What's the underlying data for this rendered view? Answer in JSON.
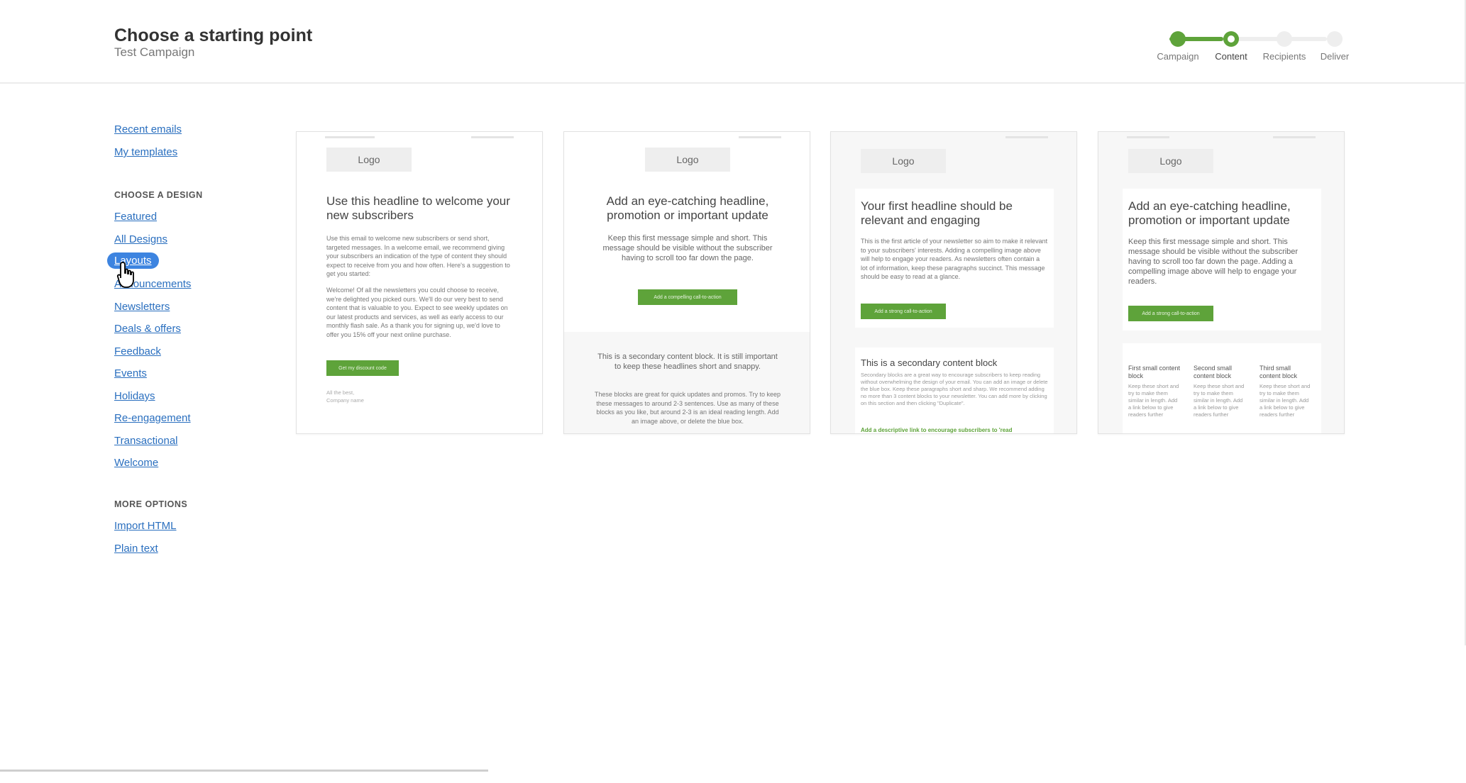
{
  "header": {
    "title": "Choose a starting point",
    "subtitle": "Test Campaign",
    "steps": [
      {
        "label": "Campaign",
        "state": "done"
      },
      {
        "label": "Content",
        "state": "current"
      },
      {
        "label": "Recipients",
        "state": "todo"
      },
      {
        "label": "Deliver",
        "state": "todo"
      }
    ],
    "progress_fraction": 0.33
  },
  "sidebar": {
    "recent_emails": "Recent emails",
    "my_templates": "My templates",
    "choose_design_heading": "CHOOSE A DESIGN",
    "designs": [
      "Featured",
      "All Designs",
      "Layouts",
      "Announcements",
      "Newsletters",
      "Deals & offers",
      "Feedback",
      "Events",
      "Holidays",
      "Re-engagement",
      "Transactional",
      "Welcome"
    ],
    "selected_design": "Layouts",
    "more_options_heading": "MORE OPTIONS",
    "import_html": "Import HTML",
    "plain_text": "Plain text"
  },
  "templates": [
    {
      "logo": "Logo",
      "headline": "Use this headline to welcome your new subscribers",
      "body1": "Use this email to welcome new subscribers or send short, targeted messages. In a welcome email, we recommend giving your subscribers an indication of the type of content they should expect to receive from you and how often. Here's a suggestion to get you started:",
      "body2": "Welcome! Of all the newsletters you could choose to receive, we're delighted you picked ours. We'll do our very best to send content that is valuable to you. Expect to see weekly updates on our latest products and services, as well as early access to our monthly flash sale. As a thank you for signing up, we'd love to offer you 15% off your next online purchase.",
      "cta": "Get my discount code",
      "signoff1": "All the best,",
      "signoff2": "Company name"
    },
    {
      "logo": "Logo",
      "headline": "Add an eye-catching headline, promotion or important update",
      "body1": "Keep this first message simple and short. This message should be visible without the subscriber having to scroll too far down the page.",
      "cta": "Add a compelling call-to-action",
      "secondary_headline": "This is a secondary content block. It is still important to keep these headlines short and snappy.",
      "body2": "These blocks are great for quick updates and promos. Try to keep these messages to around 2-3 sentences. Use as many of these blocks as you like, but around 2-3 is an ideal reading length. Add an image above, or delete the blue box."
    },
    {
      "logo": "Logo",
      "headline": "Your first headline should be relevant and engaging",
      "body1": "This is the first article of your newsletter so aim to make it relevant to your subscribers' interests. Adding a compelling image above will help to engage your readers. As newsletters often contain a lot of information, keep these paragraphs succinct. This message should be easy to read at a glance.",
      "cta": "Add a strong call-to-action",
      "secondary_headline": "This is a secondary content block",
      "body2": "Secondary blocks are a great way to encourage subscribers to keep reading without overwhelming the design of your email. You can add an image or delete the blue box. Keep these paragraphs short and sharp. We recommend adding no more than 3 content blocks to your newsletter. You can add more by clicking on this section and then clicking \"Duplicate\".",
      "link": "Add a descriptive link to encourage subscribers to 'read"
    },
    {
      "logo": "Logo",
      "headline": "Add an eye-catching headline, promotion or important update",
      "body1": "Keep this first message simple and short. This message should be visible without the subscriber having to scroll too far down the page. Adding a compelling image above will help to engage your readers.",
      "cta": "Add a strong call-to-action",
      "columns": [
        {
          "title": "First small content block",
          "text": "Keep these short and try to make them similar in length. Add a link below to give readers further"
        },
        {
          "title": "Second small content block",
          "text": "Keep these short and try to make them similar in length. Add a link below to give readers further"
        },
        {
          "title": "Third small content block",
          "text": "Keep these short and try to make them similar in length. Add a link below to give readers further"
        }
      ]
    }
  ],
  "colors": {
    "accent_green": "#5ea33a",
    "link_blue": "#2a6fbf",
    "selected_pill": "#3d84e0"
  }
}
